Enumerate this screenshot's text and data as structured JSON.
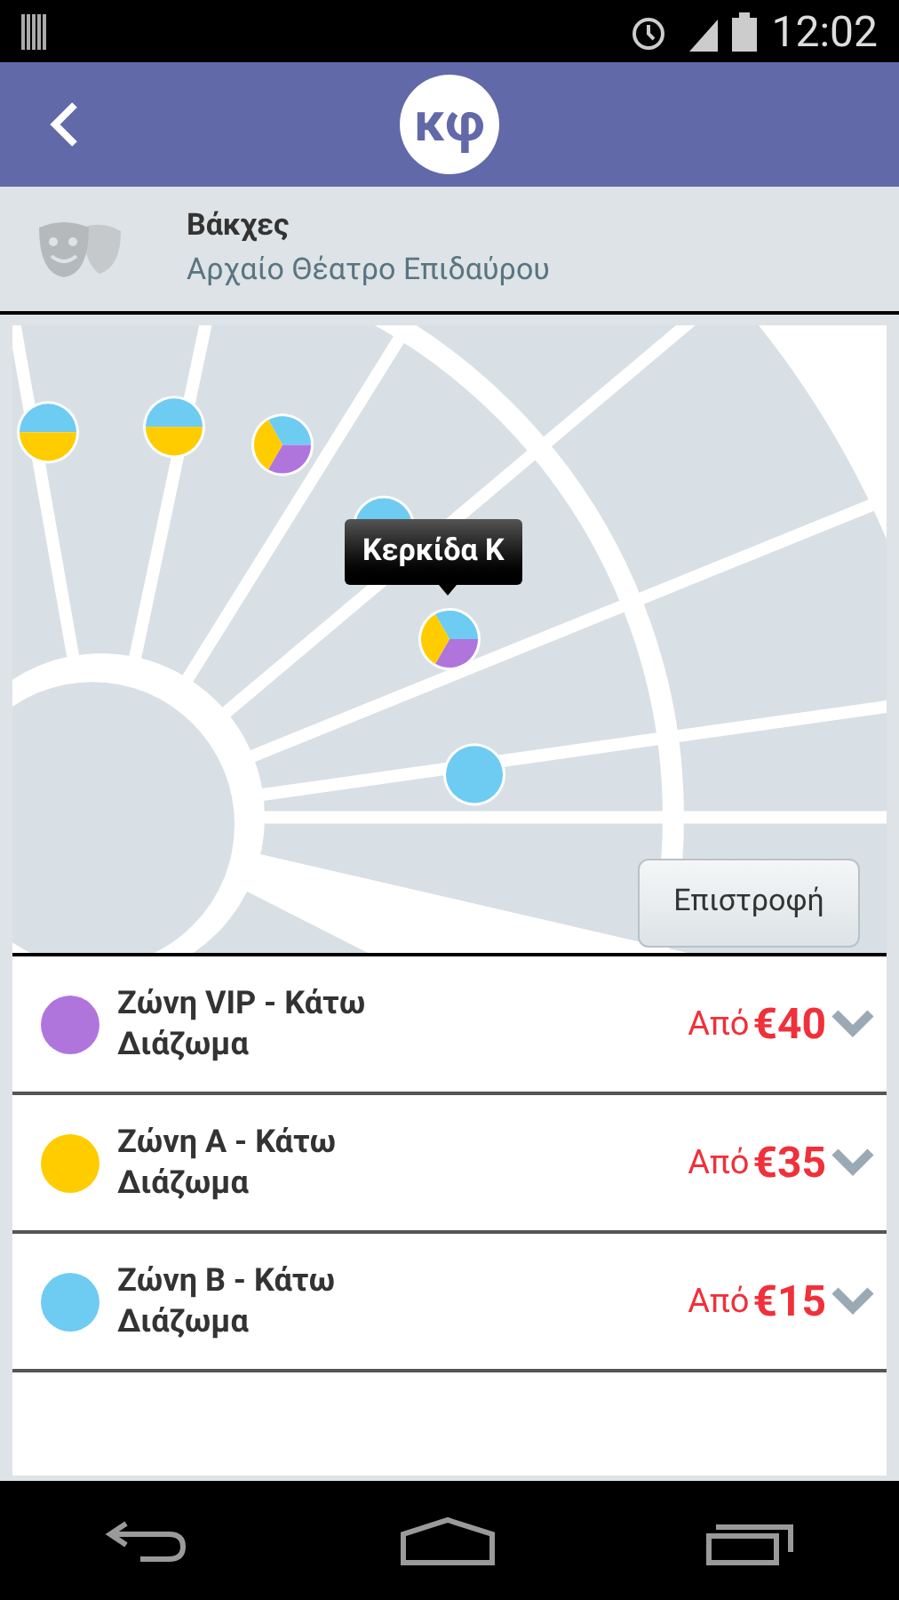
{
  "status_bar": {
    "time": "12:02"
  },
  "header": {
    "logo_text": "κφ"
  },
  "event": {
    "title": "Βάκχες",
    "venue": "Αρχαίο Θέατρο Επιδαύρου"
  },
  "map": {
    "tooltip": "Κερκίδα Κ",
    "return_button": "Επιστροφή"
  },
  "zones": [
    {
      "name": "Ζώνη VIP - Κάτω Διάζωμα",
      "color": "#b075dd",
      "prefix": "Από",
      "price": "€40",
      "expanded": false
    },
    {
      "name": "Ζώνη Α - Κάτω Διάζωμα",
      "color": "#ffcc00",
      "prefix": "Από",
      "price": "€35",
      "expanded": false
    },
    {
      "name": "Ζώνη Β - Κάτω Διάζωμα",
      "color": "#6ecbf2",
      "prefix": "Από",
      "price": "€15",
      "expanded": false
    }
  ]
}
